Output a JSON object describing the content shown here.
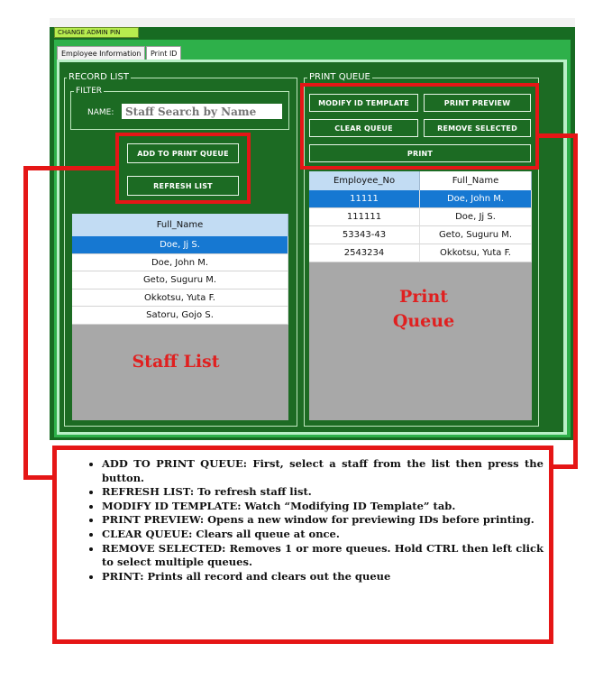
{
  "admin_tab": "CHANGE ADMIN PIN",
  "tabs": [
    {
      "label": "Employee Information"
    },
    {
      "label": "Print ID"
    }
  ],
  "record_list": {
    "title": "RECORD LIST",
    "filter": {
      "title": "FILTER",
      "name_label": "NAME:",
      "name_placeholder": "Staff Search by Name"
    },
    "buttons": {
      "add_to_print_queue": "ADD TO PRINT QUEUE",
      "refresh_list": "REFRESH LIST"
    },
    "column": "Full_Name",
    "rows": [
      "Doe, Jj S.",
      "Doe, John M.",
      "Geto, Suguru M.",
      "Okkotsu, Yuta F.",
      "Satoru, Gojo S."
    ],
    "selected_index": 0
  },
  "print_queue": {
    "title": "PRINT QUEUE",
    "buttons": {
      "modify_id_template": "MODIFY ID TEMPLATE",
      "print_preview": "PRINT PREVIEW",
      "clear_queue": "CLEAR QUEUE",
      "remove_selected": "REMOVE SELECTED",
      "print": "PRINT"
    },
    "columns": [
      "Employee_No",
      "Full_Name"
    ],
    "rows": [
      [
        "11111",
        "Doe, John M."
      ],
      [
        "111111",
        "Doe, Jj S."
      ],
      [
        "53343-43",
        "Geto, Suguru M."
      ],
      [
        "2543234",
        "Okkotsu, Yuta F."
      ]
    ],
    "selected_index": 0
  },
  "annotations": {
    "staff_list": "Staff List",
    "print_queue_line1": "Print",
    "print_queue_line2": "Queue",
    "notes": [
      "ADD TO PRINT QUEUE: First, select a staff from the list then press the button.",
      "REFRESH LIST: To refresh staff list.",
      "MODIFY ID TEMPLATE: Watch “Modifying ID Template” tab.",
      "PRINT PREVIEW: Opens a new window for previewing IDs before printing.",
      "CLEAR QUEUE: Clears all queue at once.",
      "REMOVE SELECTED: Removes 1 or more queues. Hold CTRL then left click to select multiple queues.",
      "PRINT: Prints all record and clears out the queue"
    ]
  },
  "colors": {
    "window_green": "#176b22",
    "tab_green": "#2eb04a",
    "highlight_red": "#e51616",
    "selection_blue": "#1678d2",
    "header_blue": "#c2dcf3"
  }
}
